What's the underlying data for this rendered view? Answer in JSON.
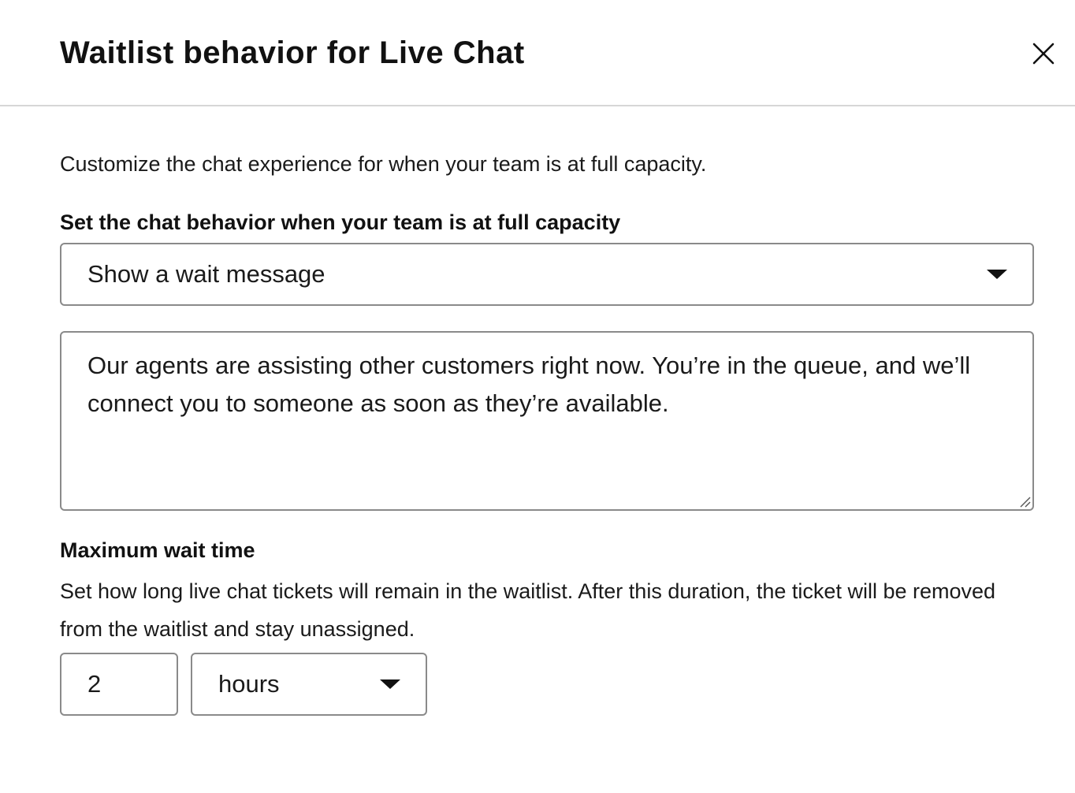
{
  "modal": {
    "title": "Waitlist behavior for Live Chat",
    "close_icon": "close-icon"
  },
  "intro": "Customize the chat experience for when your team is at full capacity.",
  "behavior": {
    "label": "Set the chat behavior when your team is at full capacity",
    "selected": "Show a wait message",
    "caret_icon": "chevron-down-icon"
  },
  "wait_message": {
    "value": "Our agents are assisting other customers right now. You’re in the queue, and we’ll connect you to someone as soon as they’re available."
  },
  "max_wait": {
    "label": "Maximum wait time",
    "description": "Set how long live chat tickets will remain in the waitlist. After this duration, the ticket will be removed from the waitlist and stay unassigned.",
    "amount": "2",
    "unit": "hours"
  }
}
